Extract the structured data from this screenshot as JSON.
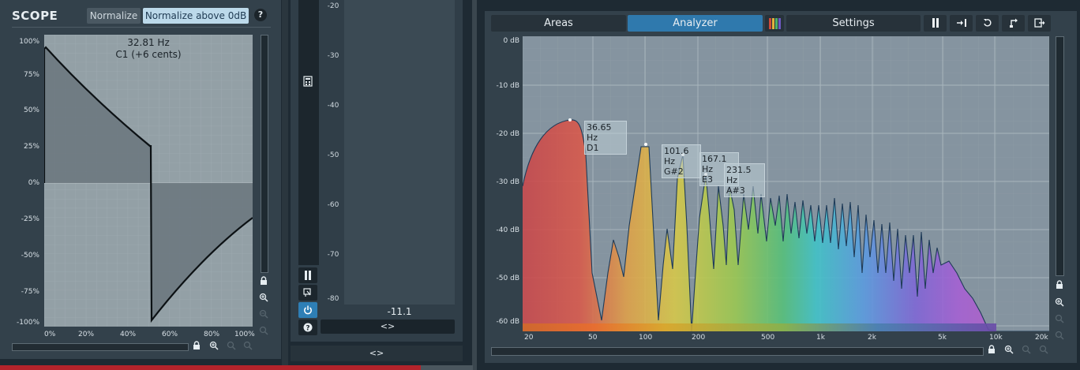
{
  "scope": {
    "title": "SCOPE",
    "normalize_label": "Normalize",
    "normalize_above_label": "Normalize above 0dB",
    "help_glyph": "?",
    "cursor_freq": "32.81 Hz",
    "cursor_note": "C1 (+6 cents)",
    "y_axis": [
      "100%",
      "75%",
      "50%",
      "25%",
      "0%",
      "-25%",
      "-50%",
      "-75%",
      "-100%"
    ],
    "x_axis": [
      "0%",
      "20%",
      "40%",
      "60%",
      "80%",
      "100%"
    ],
    "icons": {
      "lock": "lock-icon",
      "zoom_in": "zoom-in-icon",
      "zoom_out": "zoom-out-icon",
      "zoom_reset": "zoom-reset-icon"
    }
  },
  "meter": {
    "db_labels": [
      "-20",
      "-30",
      "-40",
      "-50",
      "-60",
      "-70",
      "-80"
    ],
    "value": "-11.1",
    "expand_glyph": "<>",
    "bottom_expand_glyph": "<>",
    "icons": {
      "calculator": "calculator-icon",
      "pause": "pause-icon",
      "flag": "flag-icon",
      "power": "power-icon",
      "help": "help-icon"
    }
  },
  "analyzer": {
    "tabs": {
      "areas": "Areas",
      "analyzer": "Analyzer",
      "settings": "Settings"
    },
    "active_tab": "Analyzer",
    "active_color": "#2f79ad",
    "toolbar_icons": [
      "pause-icon",
      "step-forward-icon",
      "reset-icon",
      "undo-icon",
      "export-icon"
    ],
    "db_axis": [
      "0 dB",
      "-10 dB",
      "-20 dB",
      "-30 dB",
      "-40 dB",
      "-50 dB",
      "-60 dB"
    ],
    "freq_axis": [
      "20",
      "50",
      "100",
      "200",
      "500",
      "1k",
      "2k",
      "5k",
      "10k",
      "20k"
    ],
    "peaks": [
      {
        "freq": "36.65 Hz",
        "note": "D1"
      },
      {
        "freq": "101.6 Hz",
        "note": "G#2"
      },
      {
        "freq": "167.1 Hz",
        "note": "E3"
      },
      {
        "freq": "231.5 Hz",
        "note": "A#3"
      }
    ]
  }
}
